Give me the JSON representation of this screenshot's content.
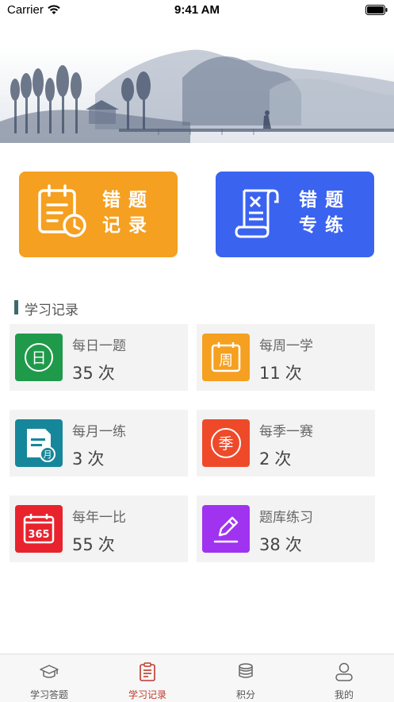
{
  "status_bar": {
    "carrier": "Carrier",
    "time": "9:41 AM"
  },
  "actions": [
    {
      "label": "错题记录",
      "color": "#f5a020",
      "icon": "calendar-clock-icon"
    },
    {
      "label": "错题专练",
      "color": "#3a63f0",
      "icon": "scroll-exam-icon"
    }
  ],
  "section": {
    "title": "学习记录"
  },
  "stats": [
    {
      "name": "每日一题",
      "count": "35",
      "unit": "次",
      "color": "#1f9a4b",
      "icon": "day-icon"
    },
    {
      "name": "每周一学",
      "count": "11",
      "unit": "次",
      "color": "#f5a020",
      "icon": "week-icon"
    },
    {
      "name": "每月一练",
      "count": "3",
      "unit": "次",
      "color": "#16879a",
      "icon": "month-icon"
    },
    {
      "name": "每季一赛",
      "count": "2",
      "unit": "次",
      "color": "#ee4a2a",
      "icon": "season-icon"
    },
    {
      "name": "每年一比",
      "count": "55",
      "unit": "次",
      "color": "#e8232e",
      "icon": "year-365-icon"
    },
    {
      "name": "题库练习",
      "count": "38",
      "unit": "次",
      "color": "#a033f0",
      "icon": "edit-pen-icon"
    }
  ],
  "stat_icon_glyphs": {
    "day": "日",
    "week": "周",
    "month": "月",
    "season": "季",
    "year": "365"
  },
  "tabbar": {
    "active_color": "#c0392b",
    "tabs": [
      {
        "label": "学习答题",
        "icon": "graduation-cap-icon"
      },
      {
        "label": "学习记录",
        "icon": "clipboard-list-icon",
        "active": true
      },
      {
        "label": "积分",
        "icon": "coins-stack-icon"
      },
      {
        "label": "我的",
        "icon": "user-profile-icon"
      }
    ]
  }
}
